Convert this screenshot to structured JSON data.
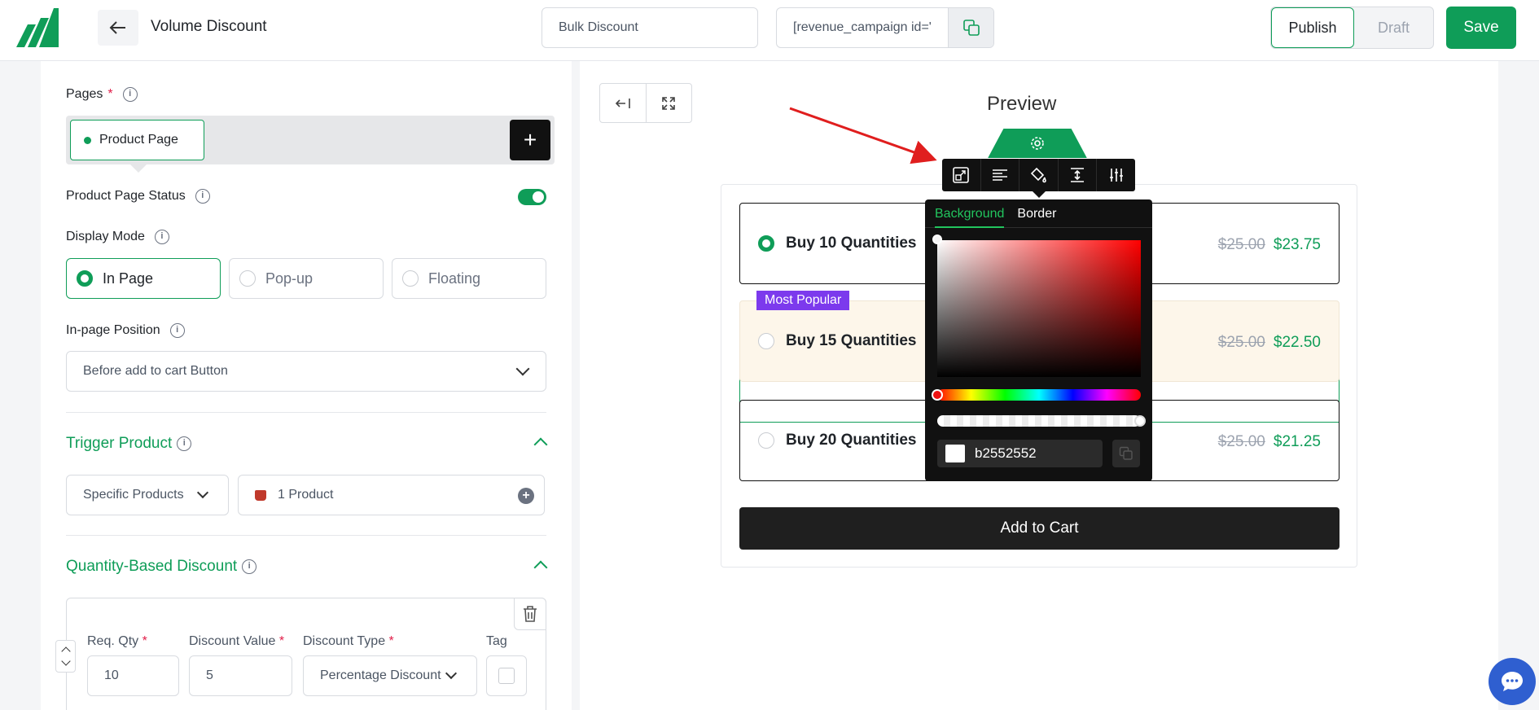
{
  "header": {
    "title": "Volume Discount",
    "campaign_name": "Bulk Discount",
    "shortcode": "[revenue_campaign id='",
    "publish_label": "Publish",
    "draft_label": "Draft",
    "save_label": "Save"
  },
  "settings": {
    "pages_label": "Pages",
    "page_chip": "Product Page",
    "status_label": "Product Page Status",
    "status_on": true,
    "display_mode_label": "Display Mode",
    "display_modes": [
      "In Page",
      "Pop-up",
      "Floating"
    ],
    "display_mode_selected": "In Page",
    "position_label": "In-page Position",
    "position_value": "Before add to cart Button"
  },
  "trigger": {
    "title": "Trigger Product",
    "type": "Specific Products",
    "products": "1 Product"
  },
  "quantity_discount": {
    "title": "Quantity-Based Discount",
    "req_qty_label": "Req. Qty",
    "discount_value_label": "Discount Value",
    "discount_type_label": "Discount Type",
    "tag_label": "Tag",
    "req_qty": "10",
    "discount_value": "5",
    "discount_type": "Percentage Discount"
  },
  "preview": {
    "title": "Preview",
    "tiers": [
      {
        "label": "Buy 10 Quantities",
        "old_price": "$25.00",
        "new_price": "$23.75"
      },
      {
        "label": "Buy 15 Quantities",
        "old_price": "$25.00",
        "new_price": "$22.50"
      },
      {
        "label": "Buy 20 Quantities",
        "old_price": "$25.00",
        "new_price": "$21.25"
      }
    ],
    "badge": "Most Popular",
    "cart_button": "Add to Cart"
  },
  "color_picker": {
    "tabs": [
      "Background",
      "Border"
    ],
    "hex": "b2552552"
  },
  "colors": {
    "accent": "#0f9d58",
    "badge": "#7c3aed",
    "popular_bg": "#fdf6ea"
  }
}
